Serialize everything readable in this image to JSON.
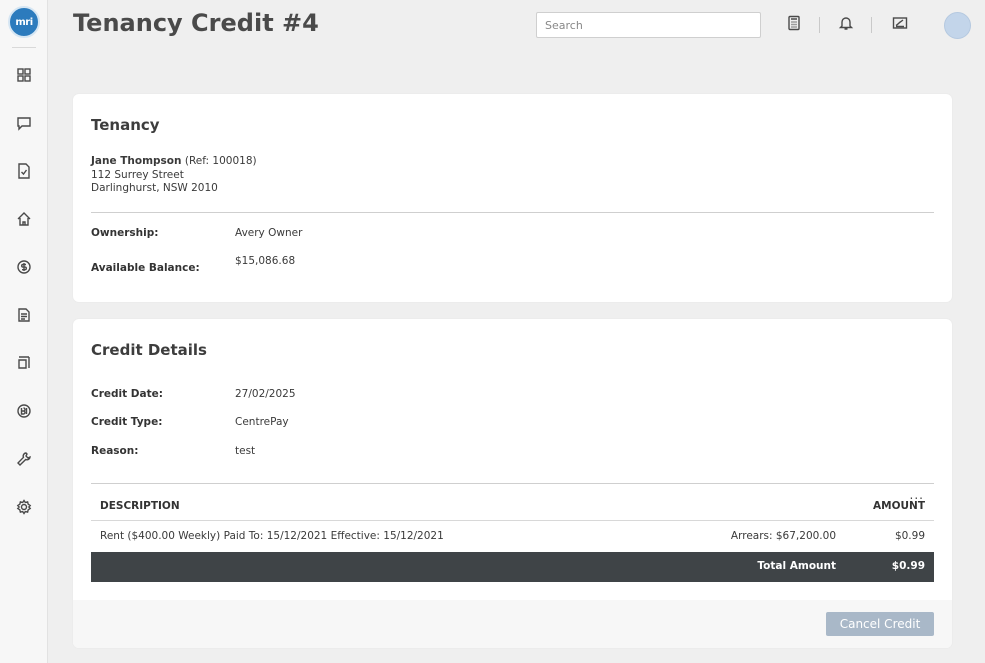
{
  "page": {
    "title": "Tenancy Credit #4"
  },
  "header": {
    "search_placeholder": "Search"
  },
  "logo": {
    "text": "mri"
  },
  "tenancy": {
    "section_title": "Tenancy",
    "name": "Jane Thompson",
    "ref": "(Ref: 100018)",
    "address_line1": "112 Surrey Street",
    "address_line2": "Darlinghurst, NSW 2010",
    "ownership_label": "Ownership:",
    "ownership_value": "Avery Owner",
    "balance_label": "Available Balance:",
    "balance_value": "$15,086.68"
  },
  "credit": {
    "section_title": "Credit Details",
    "date_label": "Credit Date:",
    "date_value": "27/02/2025",
    "type_label": "Credit Type:",
    "type_value": "CentrePay",
    "reason_label": "Reason:",
    "reason_value": "test",
    "table": {
      "col_description": "DESCRIPTION",
      "col_amount": "AMOUNT",
      "menu": "...",
      "rows": [
        {
          "description": "Rent ($400.00 Weekly) Paid To: 15/12/2021 Effective: 15/12/2021",
          "arrears": "Arrears: $67,200.00",
          "amount": "$0.99"
        }
      ],
      "total_label": "Total Amount",
      "total_value": "$0.99"
    },
    "cancel_label": "Cancel Credit"
  },
  "icons": {
    "sidebar": [
      "dashboard-icon",
      "chat-icon",
      "document-check-icon",
      "home-icon",
      "dollar-icon",
      "report-icon",
      "inspection-icon",
      "bi-icon",
      "tools-icon",
      "settings-icon"
    ],
    "header": [
      "calculator-icon",
      "bell-icon",
      "signature-icon"
    ]
  },
  "colors": {
    "brand": "#2c7bbd",
    "total_bar": "#3f4447",
    "cancel_button": "#a9b8c8"
  }
}
